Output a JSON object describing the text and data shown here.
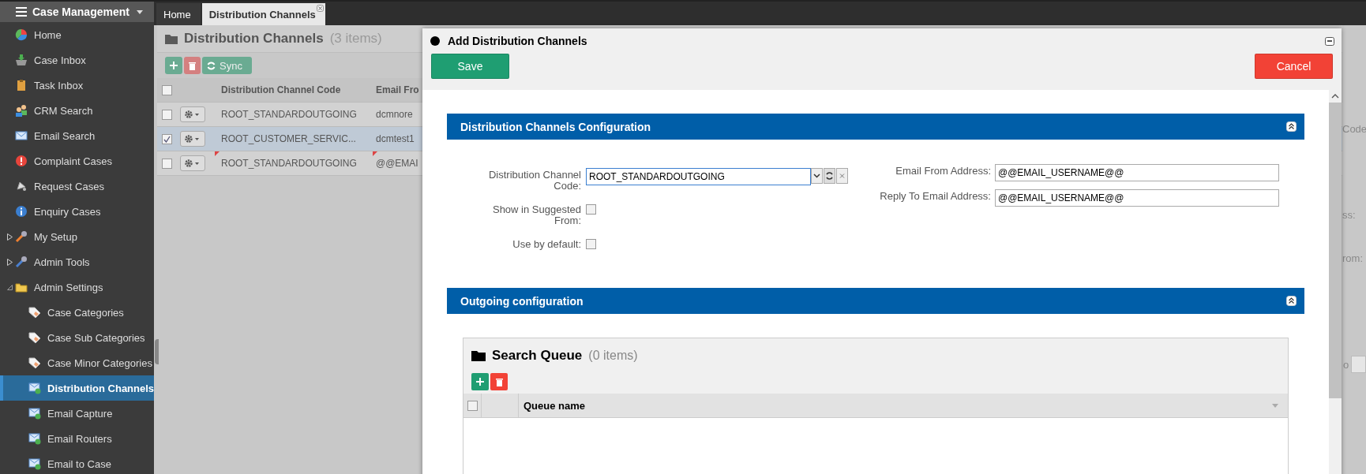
{
  "sidebar": {
    "title": "Case Management",
    "items": [
      {
        "label": "Home",
        "selected": false
      },
      {
        "label": "Case Inbox",
        "selected": false
      },
      {
        "label": "Task Inbox",
        "selected": false
      },
      {
        "label": "CRM Search",
        "selected": false
      },
      {
        "label": "Email Search",
        "selected": false
      },
      {
        "label": "Complaint Cases",
        "selected": false
      },
      {
        "label": "Request Cases",
        "selected": false
      },
      {
        "label": "Enquiry Cases",
        "selected": false
      },
      {
        "label": "My Setup",
        "selected": false,
        "expanded": false
      },
      {
        "label": "Admin Tools",
        "selected": false,
        "expanded": false
      },
      {
        "label": "Admin Settings",
        "selected": false,
        "expanded": true,
        "children": [
          {
            "label": "Case Categories",
            "selected": false
          },
          {
            "label": "Case Sub Categories",
            "selected": false
          },
          {
            "label": "Case Minor Categories",
            "selected": false
          },
          {
            "label": "Distribution Channels",
            "selected": true
          },
          {
            "label": "Email Capture",
            "selected": false
          },
          {
            "label": "Email Routers",
            "selected": false
          },
          {
            "label": "Email to Case",
            "selected": false
          }
        ]
      }
    ]
  },
  "tabs": [
    {
      "label": "Home",
      "selected": false,
      "closable": false
    },
    {
      "label": "Distribution Channels",
      "selected": true,
      "closable": true
    }
  ],
  "list": {
    "title": "Distribution Channels",
    "count": "(3 items)",
    "sync_label": "Sync",
    "columns": [
      "Distribution Channel Code",
      "Email Fro"
    ],
    "all_checked": false,
    "rows": [
      {
        "checked": false,
        "selected": false,
        "modified": false,
        "cells": [
          "ROOT_STANDARDOUTGOING",
          "dcmnore"
        ]
      },
      {
        "checked": true,
        "selected": true,
        "modified": false,
        "cells": [
          "ROOT_CUSTOMER_SERVIC...",
          "dcmtest1"
        ]
      },
      {
        "checked": false,
        "selected": false,
        "modified": true,
        "cells": [
          "ROOT_STANDARDOUTGOING",
          "@@EMAI"
        ]
      }
    ]
  },
  "background_fragments": [
    "Code",
    "ss:",
    "rom:",
    "o"
  ],
  "dialog": {
    "title": "Add Distribution Channels",
    "save": "Save",
    "cancel": "Cancel",
    "sections": [
      {
        "title": "Distribution Channels Configuration",
        "expanded": true,
        "kind": "form",
        "left_fields": [
          {
            "kind": "combo",
            "label": "Distribution Channel Code:",
            "value": "ROOT_STANDARDOUTGOING"
          },
          {
            "kind": "checkbox",
            "label": "Show in Suggested From:",
            "checked": false
          },
          {
            "kind": "checkbox",
            "label": "Use by default:",
            "checked": false
          }
        ],
        "right_fields": [
          {
            "kind": "text",
            "label": "Email From Address:",
            "value": "@@EMAIL_USERNAME@@"
          },
          {
            "kind": "text",
            "label": "Reply To Email Address:",
            "value": "@@EMAIL_USERNAME@@"
          }
        ]
      },
      {
        "title": "Outgoing configuration",
        "expanded": true,
        "kind": "grid",
        "grid": {
          "title": "Search Queue",
          "count": "(0 items)",
          "columns": [
            "Queue name"
          ],
          "all_checked": false
        }
      }
    ]
  }
}
